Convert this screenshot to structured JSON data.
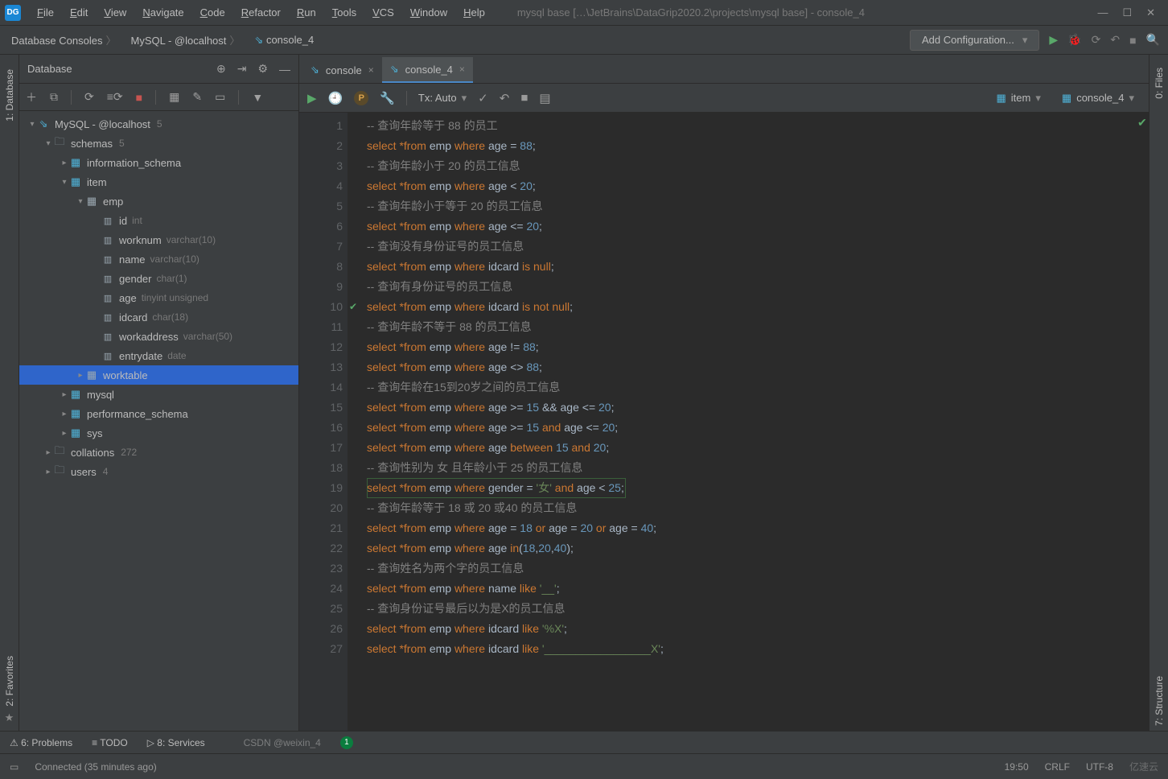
{
  "menubar": {
    "items": [
      "File",
      "Edit",
      "View",
      "Navigate",
      "Code",
      "Refactor",
      "Run",
      "Tools",
      "VCS",
      "Window",
      "Help"
    ]
  },
  "windowTitle": "mysql base […\\JetBrains\\DataGrip2020.2\\projects\\mysql base] - console_4",
  "breadcrumbs": [
    "Database Consoles",
    "MySQL - @localhost",
    "console_4"
  ],
  "addConfig": "Add Configuration...",
  "database": {
    "title": "Database",
    "root": {
      "name": "MySQL - @localhost",
      "count": "5"
    },
    "schemasLabel": "schemas",
    "schemasCount": "5",
    "schemas": [
      "information_schema",
      "item",
      "mysql",
      "performance_schema",
      "sys"
    ],
    "item": {
      "tables": [
        "emp",
        "worktable"
      ],
      "emp_columns": [
        {
          "name": "id",
          "type": "int"
        },
        {
          "name": "worknum",
          "type": "varchar(10)"
        },
        {
          "name": "name",
          "type": "varchar(10)"
        },
        {
          "name": "gender",
          "type": "char(1)"
        },
        {
          "name": "age",
          "type": "tinyint unsigned"
        },
        {
          "name": "idcard",
          "type": "char(18)"
        },
        {
          "name": "workaddress",
          "type": "varchar(50)"
        },
        {
          "name": "entrydate",
          "type": "date"
        }
      ]
    },
    "collations": {
      "name": "collations",
      "count": "272"
    },
    "users": {
      "name": "users",
      "count": "4"
    }
  },
  "tabs": [
    {
      "name": "console"
    },
    {
      "name": "console_4"
    }
  ],
  "editorToolbar": {
    "txMode": "Tx: Auto",
    "schema": "item",
    "console": "console_4"
  },
  "code": {
    "1": {
      "t": "cmt",
      "s": "-- 查询年龄等于 88 的员工"
    },
    "2": {
      "t": "sql",
      "s": "select *from emp where age = 88;"
    },
    "3": {
      "t": "cmt",
      "s": "-- 查询年龄小于 20 的员工信息"
    },
    "4": {
      "t": "sql",
      "s": "select *from emp where age < 20;"
    },
    "5": {
      "t": "cmt",
      "s": "-- 查询年龄小于等于 20 的员工信息"
    },
    "6": {
      "t": "sql",
      "s": "select *from emp where age <= 20;"
    },
    "7": {
      "t": "cmt",
      "s": "-- 查询没有身份证号的员工信息"
    },
    "8": {
      "t": "sql",
      "s": "select *from emp where idcard is null;"
    },
    "9": {
      "t": "cmt",
      "s": "-- 查询有身份证号的员工信息"
    },
    "10": {
      "t": "sql",
      "s": "select *from emp where idcard is not null;"
    },
    "11": {
      "t": "cmt",
      "s": "-- 查询年龄不等于 88 的员工信息"
    },
    "12": {
      "t": "sql",
      "s": "select *from emp where age != 88;"
    },
    "13": {
      "t": "sql",
      "s": "select *from emp where age <> 88;"
    },
    "14": {
      "t": "cmt",
      "s": "-- 查询年龄在15到20岁之间的员工信息"
    },
    "15": {
      "t": "sql",
      "s": "select *from emp where age >= 15 && age <= 20;"
    },
    "16": {
      "t": "sql",
      "s": "select *from emp where age >= 15 and age <= 20;"
    },
    "17": {
      "t": "sql",
      "s": "select *from emp where age between 15 and 20;"
    },
    "18": {
      "t": "cmt",
      "s": "-- 查询性别为 女 且年龄小于 25 的员工信息"
    },
    "19": {
      "t": "sql",
      "s": "select *from emp where gender = '女' and age < 25;"
    },
    "20": {
      "t": "cmt",
      "s": "-- 查询年龄等于 18 或 20 或40 的员工信息"
    },
    "21": {
      "t": "sql",
      "s": "select *from emp where age = 18 or age = 20 or age = 40;"
    },
    "22": {
      "t": "sql",
      "s": "select *from emp where age in(18,20,40);"
    },
    "23": {
      "t": "cmt",
      "s": "-- 查询姓名为两个字的员工信息"
    },
    "24": {
      "t": "sql",
      "s": "select *from emp where name like '__';"
    },
    "25": {
      "t": "cmt",
      "s": "-- 查询身份证号最后以为是X的员工信息"
    },
    "26": {
      "t": "sql",
      "s": "select *from emp where idcard like '%X';"
    },
    "27": {
      "t": "sql",
      "s": "select *from emp where idcard like '_________________X';"
    }
  },
  "cursorLine": 19,
  "checkLine": 10,
  "problemsBar": {
    "problems": "6: Problems",
    "todo": "TODO",
    "services": "8: Services"
  },
  "status": {
    "connected": "Connected (35 minutes ago)",
    "pos": "19:50",
    "eol": "CRLF",
    "enc": "UTF-8",
    "notif": "1"
  },
  "sideTabs": {
    "left_top": "1: Database",
    "left_bottom": "2: Favorites",
    "right_top": "0: Files",
    "right_bottom": "7: Structure"
  },
  "watermark_csdn": "CSDN @weixin_4",
  "watermark_cloud": "亿速云"
}
